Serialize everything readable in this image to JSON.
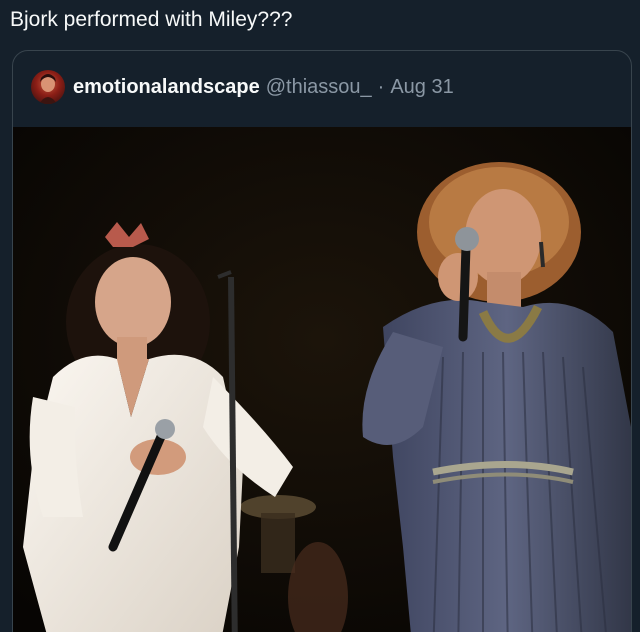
{
  "post": {
    "text": "Bjork performed with Miley???"
  },
  "quoted_post": {
    "display_name": "emotionalandscape",
    "handle": "@thiassou_",
    "separator": "·",
    "date": "Aug 31",
    "avatar_icon": "avatar-image",
    "media": {
      "type": "photo",
      "colors": {
        "background": "#0c0905",
        "white_dress": "#f2ece4",
        "blue_dress": "#4a4f68",
        "skin": "#c98a66",
        "hair_dark": "#2a1810",
        "hair_light": "#b0733c"
      }
    }
  },
  "theme": {
    "background": "#15202b",
    "text_primary": "#f7f9f9",
    "text_secondary": "#8b98a5",
    "border": "#38444d"
  }
}
